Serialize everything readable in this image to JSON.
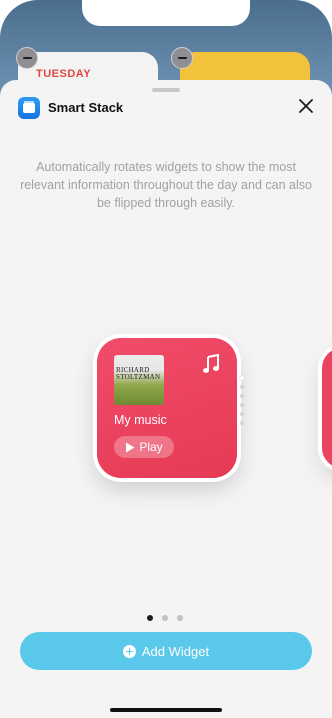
{
  "background": {
    "calendar_day": "TUESDAY",
    "calendar_color": "#e0483f",
    "notes_color": "#f2c23b"
  },
  "sheet": {
    "app_icon": "smart-stack-icon",
    "title": "Smart Stack",
    "close_icon": "close-icon",
    "description": "Automatically rotates widgets to show the most relevant information throughout the day and can also be flipped through easily."
  },
  "widget": {
    "album_title": "RICHARD STOLTZMAN",
    "label": "My music",
    "play_label": "Play",
    "accent": "#e63a55",
    "icon": "music-note-icon"
  },
  "pagination": {
    "count": 3,
    "active": 0
  },
  "add_button": {
    "label": "Add Widget",
    "color": "#5ac8ea"
  }
}
